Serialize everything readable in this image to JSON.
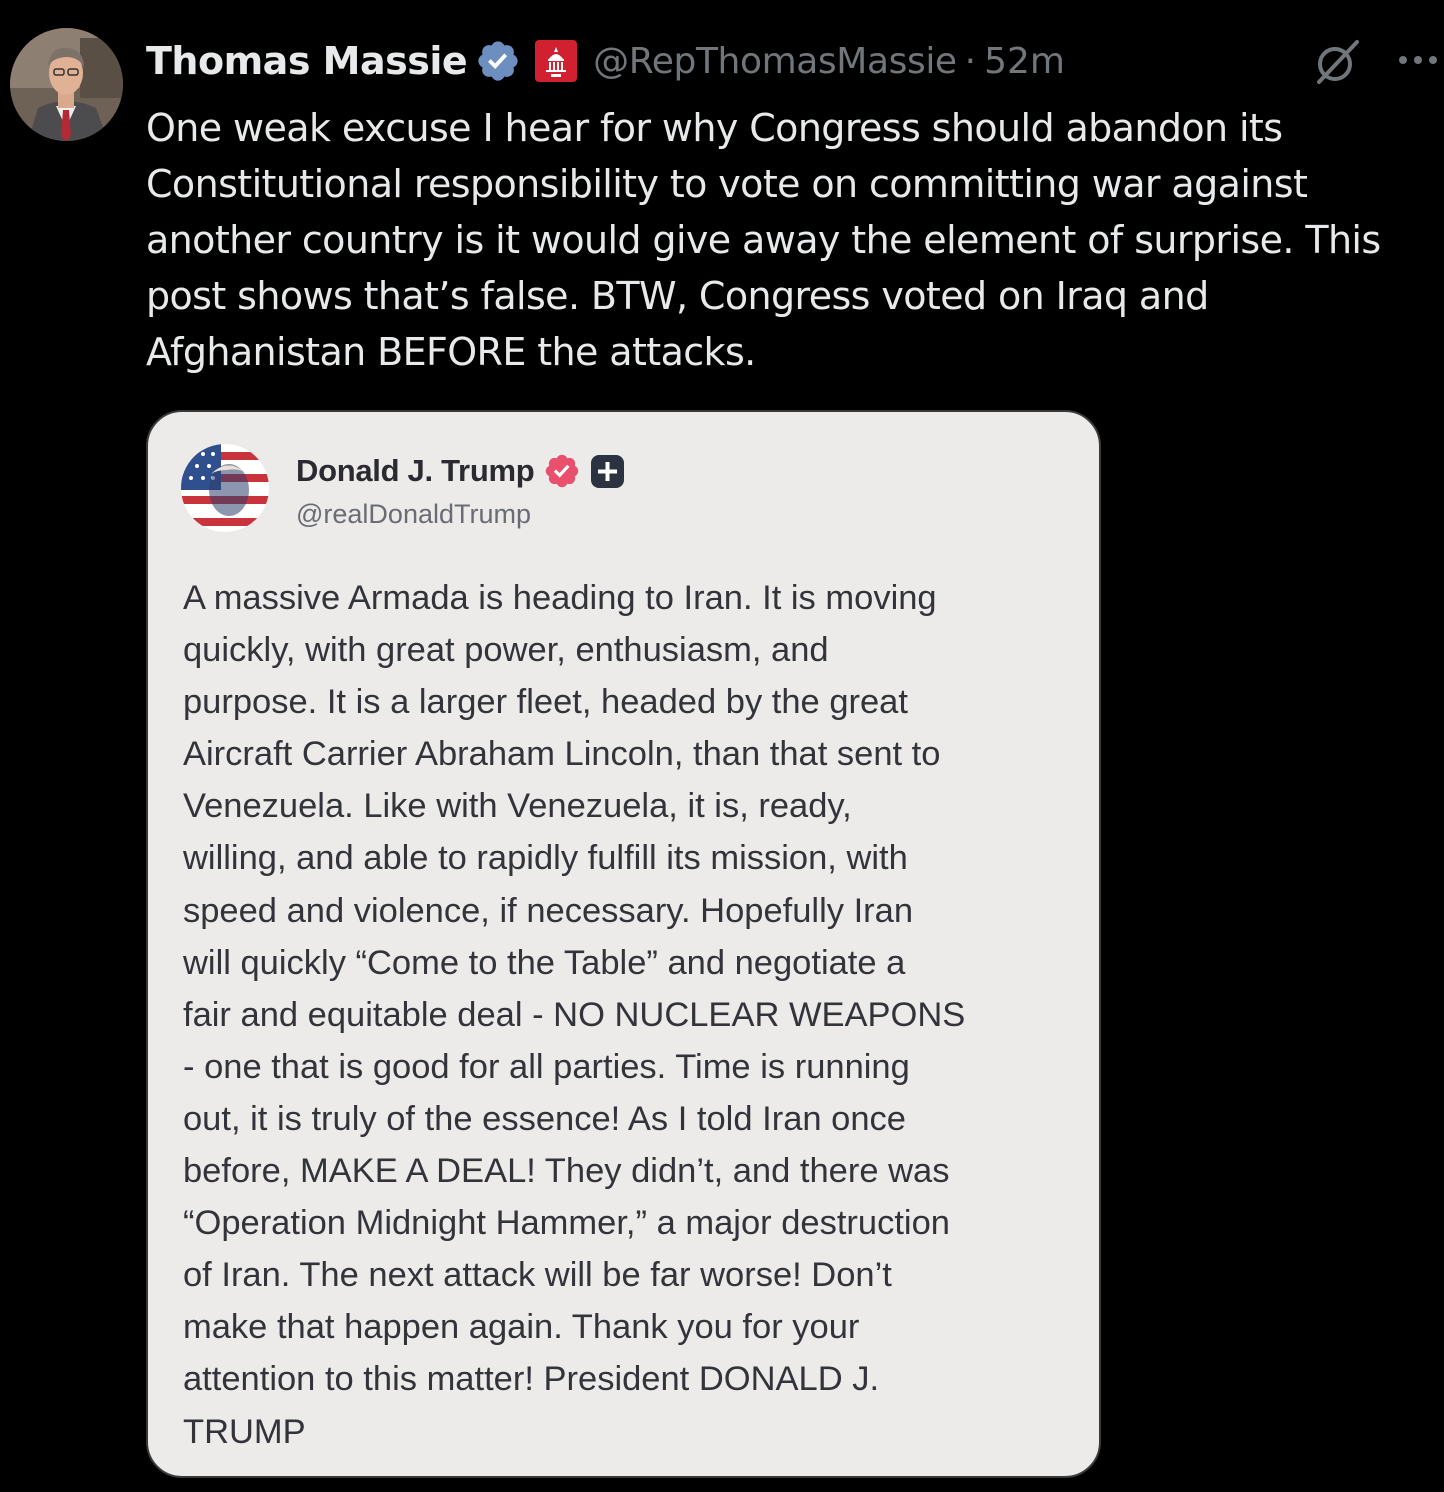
{
  "tweet": {
    "author": {
      "display_name": "Thomas Massie",
      "handle": "@RepThomasMassie",
      "avatar_icon": "profile-photo",
      "verified_icon": "verified-badge-icon",
      "affiliation_icon": "capitol-gop-badge-icon"
    },
    "separator": "·",
    "timestamp": "52m",
    "text_lines": [
      "One weak excuse I hear for why Congress should abandon its",
      "Constitutional responsibility to vote on committing war against",
      "another country is it would give away the element of surprise. This",
      "post shows that’s false. BTW, Congress voted on Iraq and",
      "Afghanistan BEFORE the attacks."
    ],
    "actions": {
      "grok_icon": "grok-icon",
      "more_icon": "more-options-icon"
    }
  },
  "quoted_screenshot": {
    "author": {
      "display_name": "Donald J. Trump",
      "handle": "@realDonaldTrump",
      "avatar_icon": "profile-photo",
      "verified_icon": "verified-badge-icon",
      "plus_icon": "plus-badge-icon"
    },
    "body_lines": [
      "A massive Armada is heading to Iran. It is moving",
      "quickly, with great power, enthusiasm, and",
      "purpose. It is a larger fleet, headed by the great",
      "Aircraft Carrier Abraham Lincoln, than that sent to",
      "Venezuela. Like with Venezuela, it is, ready,",
      "willing, and able to rapidly fulfill its mission, with",
      "speed and violence, if necessary. Hopefully Iran",
      "will quickly “Come to the Table” and negotiate a",
      "fair and equitable deal - NO NUCLEAR WEAPONS",
      "- one that is good for all parties. Time is running",
      "out, it is truly of the essence! As I told Iran once",
      "before, MAKE A DEAL! They didn’t, and there was",
      "“Operation Midnight Hammer,” a major destruction",
      "of Iran. The next attack will be far worse! Don’t",
      "make that happen again. Thank you for your",
      "attention to this matter! President DONALD J.",
      "TRUMP"
    ]
  },
  "colors": {
    "background": "#000000",
    "primary_text": "#e7e9ea",
    "secondary_text": "#71767b",
    "verified_blue": "#6d8fbf",
    "gov_red": "#d1202f",
    "card_background": "#ecebea",
    "card_text": "#33333a",
    "truth_verified_pink": "#e8506e"
  }
}
